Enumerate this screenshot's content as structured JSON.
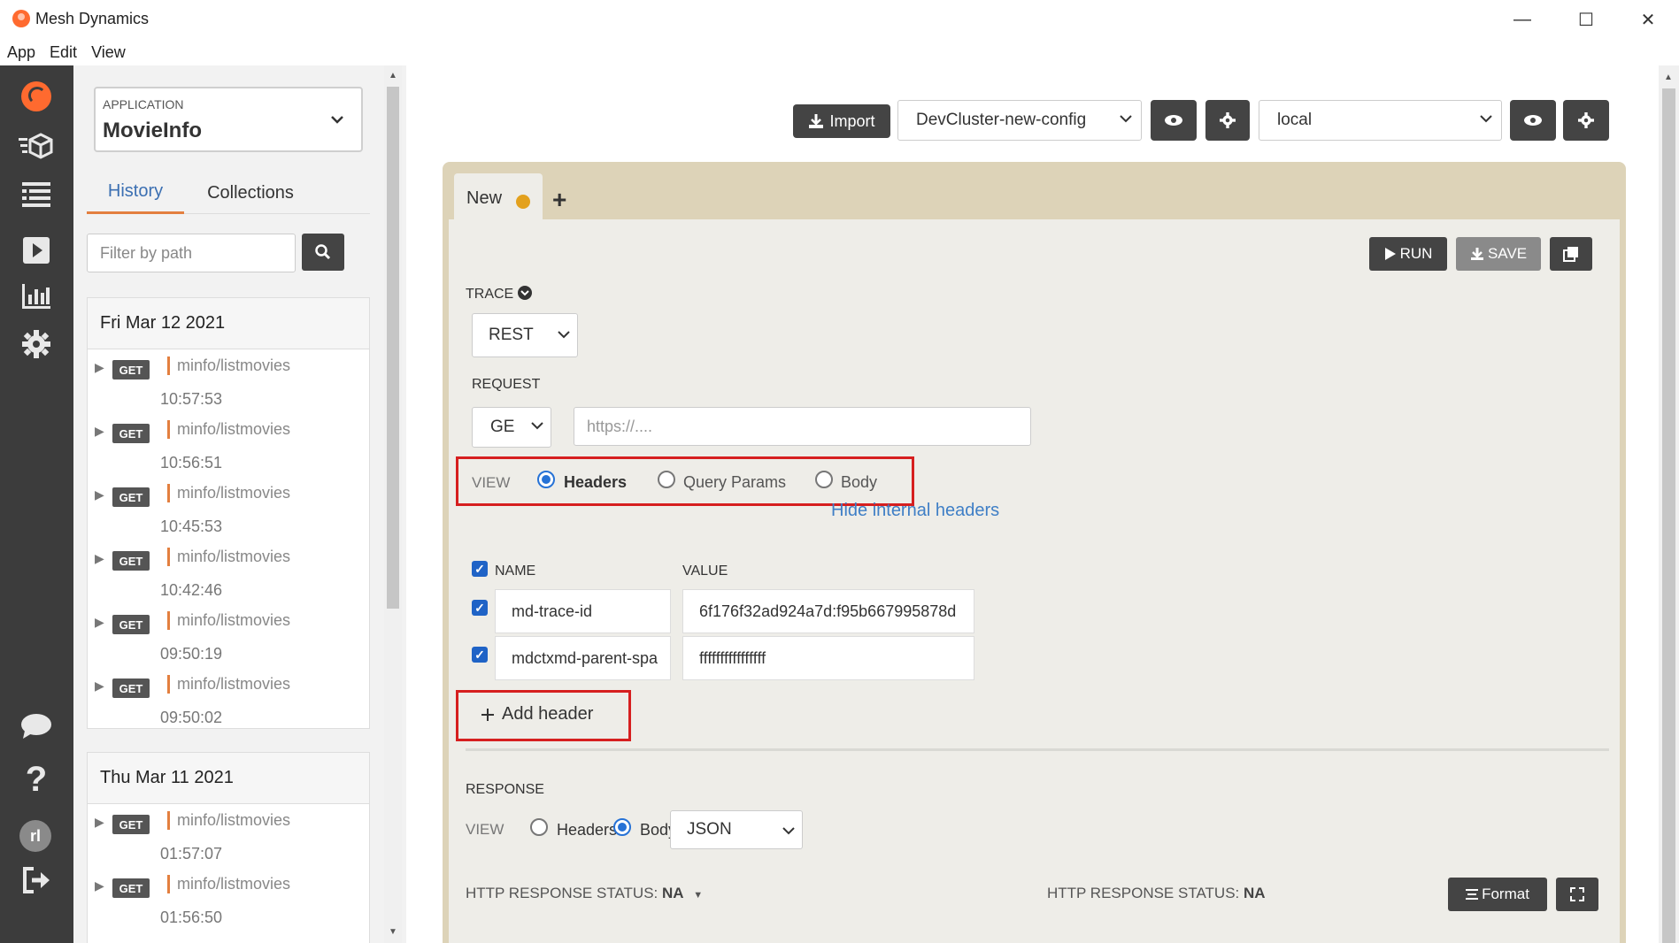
{
  "window": {
    "title": "Mesh Dynamics",
    "minimize": "—",
    "maximize": "☐",
    "close": "✕"
  },
  "menu": [
    "App",
    "Edit",
    "View"
  ],
  "rail": {
    "avatar_initials": "rl"
  },
  "sidebar": {
    "application_label": "APPLICATION",
    "application_value": "MovieInfo",
    "tabs": [
      "History",
      "Collections"
    ],
    "filter_placeholder": "Filter by path",
    "days": [
      {
        "date": "Fri Mar 12 2021",
        "items": [
          {
            "method": "GET",
            "path": "minfo/listmovies",
            "time": "10:57:53"
          },
          {
            "method": "GET",
            "path": "minfo/listmovies",
            "time": "10:56:51"
          },
          {
            "method": "GET",
            "path": "minfo/listmovies",
            "time": "10:45:53"
          },
          {
            "method": "GET",
            "path": "minfo/listmovies",
            "time": "10:42:46"
          },
          {
            "method": "GET",
            "path": "minfo/listmovies",
            "time": "09:50:19"
          },
          {
            "method": "GET",
            "path": "minfo/listmovies",
            "time": "09:50:02"
          }
        ]
      },
      {
        "date": "Thu Mar 11 2021",
        "items": [
          {
            "method": "GET",
            "path": "minfo/listmovies",
            "time": "01:57:07"
          },
          {
            "method": "GET",
            "path": "minfo/listmovies",
            "time": "01:56:50"
          }
        ]
      }
    ]
  },
  "toolbar": {
    "import_label": "Import",
    "config_select": "DevCluster-new-config",
    "env_select": "local"
  },
  "request_tabs": {
    "active_tab": "New",
    "add_tab": "+"
  },
  "actions": {
    "run": "RUN",
    "save": "SAVE"
  },
  "trace": {
    "label": "TRACE",
    "type": "REST"
  },
  "request": {
    "label": "REQUEST",
    "method": "GE",
    "url_placeholder": "https://....",
    "view_label": "VIEW",
    "view_options": [
      "Headers",
      "Query Params",
      "Body"
    ],
    "view_selected": "Headers",
    "hide_internal": "Hide internal headers",
    "headers_name_col": "NAME",
    "headers_value_col": "VALUE",
    "headers": [
      {
        "name": "md-trace-id",
        "value": "6f176f32ad924a7d:f95b667995878d"
      },
      {
        "name": "mdctxmd-parent-spa",
        "value": "ffffffffffffffff"
      }
    ],
    "add_header": "Add header"
  },
  "response": {
    "label": "RESPONSE",
    "view_label": "VIEW",
    "view_options": [
      "Headers",
      "Body"
    ],
    "view_selected": "Body",
    "format_select": "JSON",
    "status_left_label": "HTTP RESPONSE STATUS:",
    "status_left_value": "NA",
    "status_right_label": "HTTP RESPONSE STATUS:",
    "status_right_value": "NA",
    "format_button": "Format"
  }
}
